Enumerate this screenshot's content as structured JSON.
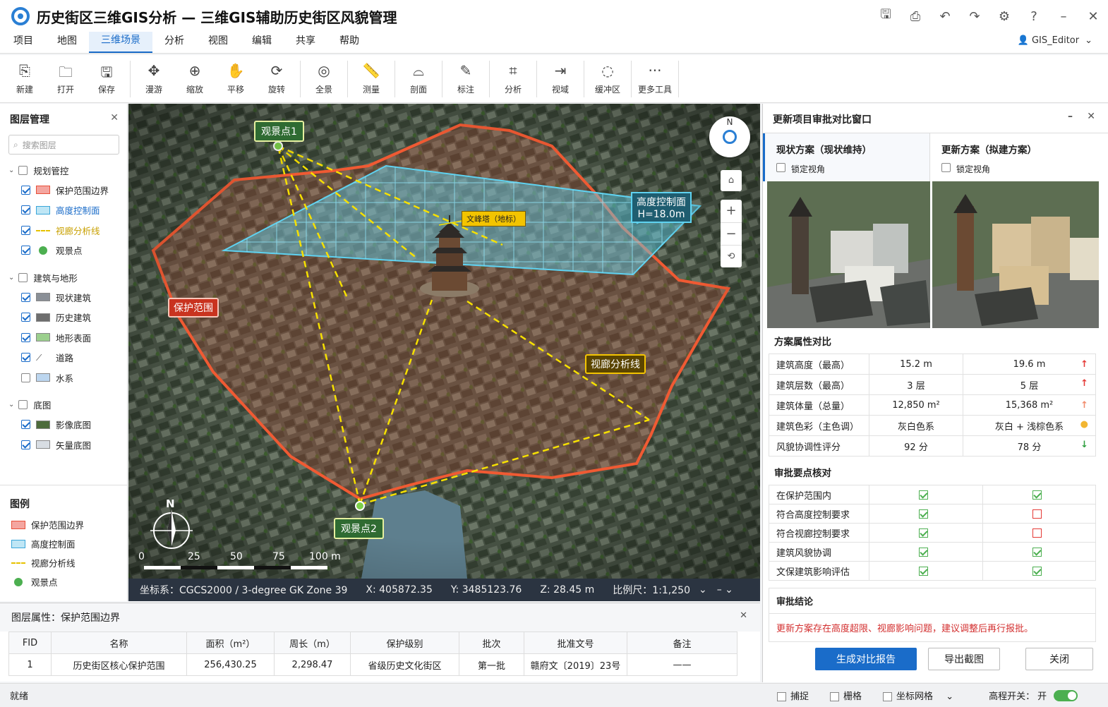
{
  "window": {
    "title": "历史街区三维GIS分析 — 三维GIS辅助历史街区风貌管理",
    "controls": [
      "save-icon",
      "print-icon",
      "undo-icon",
      "redo-icon",
      "gear-icon",
      "help-icon",
      "minimize-icon",
      "close-icon"
    ]
  },
  "menubar": {
    "items": [
      "项目",
      "地图",
      "三维场景",
      "分析",
      "视图",
      "编辑",
      "共享",
      "帮助"
    ],
    "active": "三维场景",
    "user": "GIS_Editor"
  },
  "toolbar": {
    "items": [
      {
        "label": "新建",
        "icon": "new-file-icon",
        "glyph": "⎘"
      },
      {
        "label": "打开",
        "icon": "folder-icon",
        "glyph": "🗀"
      },
      {
        "label": "保存",
        "icon": "save-icon",
        "glyph": "🖫"
      },
      {
        "label": "漫游",
        "icon": "fly-icon",
        "glyph": "✥"
      },
      {
        "label": "缩放",
        "icon": "zoom-icon",
        "glyph": "⊕"
      },
      {
        "label": "平移",
        "icon": "hand-icon",
        "glyph": "✋"
      },
      {
        "label": "旋转",
        "icon": "rotate-icon",
        "glyph": "⟳"
      },
      {
        "label": "全景",
        "icon": "panorama-icon",
        "glyph": "◎"
      },
      {
        "label": "测量",
        "icon": "ruler-icon",
        "glyph": "📏"
      },
      {
        "label": "剖面",
        "icon": "profile-icon",
        "glyph": "⌓"
      },
      {
        "label": "标注",
        "icon": "pen-icon",
        "glyph": "✎"
      },
      {
        "label": "分析",
        "icon": "analysis-icon",
        "glyph": "⌗"
      },
      {
        "label": "视域",
        "icon": "viewshed-icon",
        "glyph": "⇥"
      },
      {
        "label": "缓冲区",
        "icon": "buffer-icon",
        "glyph": "◌"
      },
      {
        "label": "更多工具",
        "icon": "more-icon",
        "glyph": "···"
      }
    ]
  },
  "layers": {
    "title": "图层管理",
    "search_placeholder": "搜索图层",
    "groups": [
      {
        "label": "规划管控",
        "checked": false,
        "items": [
          {
            "label": "保护范围边界",
            "checked": true,
            "swatch": "#f4a6a0",
            "border": "#e8503a"
          },
          {
            "label": "高度控制面",
            "checked": true,
            "swatch": "#bfe6f5",
            "border": "#3aa6d9",
            "highlight": true
          },
          {
            "label": "视廊分析线",
            "checked": true,
            "swatch": "dash",
            "color": "#e6c200",
            "highlight2": true
          },
          {
            "label": "观景点",
            "checked": true,
            "swatch": "dot",
            "color": "#4caf50"
          }
        ]
      },
      {
        "label": "建筑与地形",
        "checked": false,
        "items": [
          {
            "label": "现状建筑",
            "checked": true,
            "swatch": "#8a8f96"
          },
          {
            "label": "历史建筑",
            "checked": true,
            "swatch": "#6e6e6e"
          },
          {
            "label": "地形表面",
            "checked": true,
            "swatch": "#9bcf8d"
          },
          {
            "label": "道路",
            "checked": true,
            "swatch": "road"
          },
          {
            "label": "水系",
            "checked": false,
            "swatch": "#bcd6ef"
          }
        ]
      },
      {
        "label": "底图",
        "checked": false,
        "items": [
          {
            "label": "影像底图",
            "checked": true,
            "swatch": "#4d6b3c"
          },
          {
            "label": "矢量底图",
            "checked": true,
            "swatch": "#d8dde3"
          }
        ]
      }
    ]
  },
  "legend": {
    "title": "图例",
    "items": [
      {
        "label": "保护范围边界",
        "swatch": "#f4a6a0",
        "border": "#e8503a"
      },
      {
        "label": "高度控制面",
        "swatch": "#bfe6f5",
        "border": "#3aa6d9"
      },
      {
        "label": "视廊分析线",
        "swatch": "dash",
        "color": "#e6c200"
      },
      {
        "label": "观景点",
        "swatch": "dot",
        "color": "#4caf50"
      }
    ]
  },
  "map": {
    "labels": {
      "viewpoint1": "观景点1",
      "viewpoint2": "观景点2",
      "pagoda": "文峰塔（地标）",
      "height_plane": "高度控制面",
      "height_value": "H=18.0m",
      "protect": "保护范围",
      "corridor": "视廊分析线"
    },
    "compass_letter": "N",
    "north_letter": "N",
    "scale_ticks": [
      "0",
      "25",
      "50",
      "75",
      "100 m"
    ],
    "coords": {
      "crs": "坐标系：CGCS2000 / 3-degree GK Zone 39",
      "x": "X: 405872.35",
      "y": "Y: 3485123.76",
      "z": "Z: 28.45 m",
      "scale": "比例尺：1:1,250"
    }
  },
  "compare": {
    "title": "更新项目审批对比窗口",
    "left_title": "现状方案（现状维持）",
    "right_title": "更新方案（拟建方案）",
    "lock_label": "锁定视角",
    "attr_section": "方案属性对比",
    "rows": [
      {
        "k": "建筑高度（最高）",
        "a": "15.2 m",
        "b": "19.6 m",
        "ind": "↑",
        "color": "#e53935"
      },
      {
        "k": "建筑层数（最高）",
        "a": "3 层",
        "b": "5 层",
        "ind": "↑",
        "color": "#e53935"
      },
      {
        "k": "建筑体量（总量）",
        "a": "12,850 m²",
        "b": "15,368 m²",
        "ind": "↑",
        "color": "#f28b6b"
      },
      {
        "k": "建筑色彩（主色调）",
        "a": "灰白色系",
        "b": "灰白 + 浅棕色系",
        "ind": "●",
        "color": "#f2b632"
      },
      {
        "k": "风貌协调性评分",
        "a": "92 分",
        "b": "78 分",
        "ind": "↓",
        "color": "#2e9e3e"
      }
    ],
    "check_section": "审批要点核对",
    "checks": [
      {
        "k": "在保护范围内",
        "a": true,
        "b": true
      },
      {
        "k": "符合高度控制要求",
        "a": true,
        "b": false
      },
      {
        "k": "符合视廊控制要求",
        "a": true,
        "b": false
      },
      {
        "k": "建筑风貌协调",
        "a": true,
        "b": true
      },
      {
        "k": "文保建筑影响评估",
        "a": true,
        "b": true
      }
    ],
    "conclusion_section": "审批结论",
    "conclusion": "更新方案存在高度超限、视廊影响问题，建议调整后再行报批。",
    "buttons": {
      "generate": "生成对比报告",
      "export": "导出截图",
      "close": "关闭"
    }
  },
  "attributes": {
    "title": "图层属性：保护范围边界",
    "headers": [
      "FID",
      "名称",
      "面积（m²）",
      "周长（m）",
      "保护级别",
      "批次",
      "批准文号",
      "备注"
    ],
    "rows": [
      [
        "1",
        "历史街区核心保护范围",
        "256,430.25",
        "2,298.47",
        "省级历史文化街区",
        "第一批",
        "赣府文〔2019〕23号",
        "——"
      ]
    ]
  },
  "status": {
    "ready": "就绪",
    "snap": "捕捉",
    "grid": "栅格",
    "coordgrid": "坐标网格",
    "elevation": "高程开关：",
    "elevation_value": "开"
  }
}
